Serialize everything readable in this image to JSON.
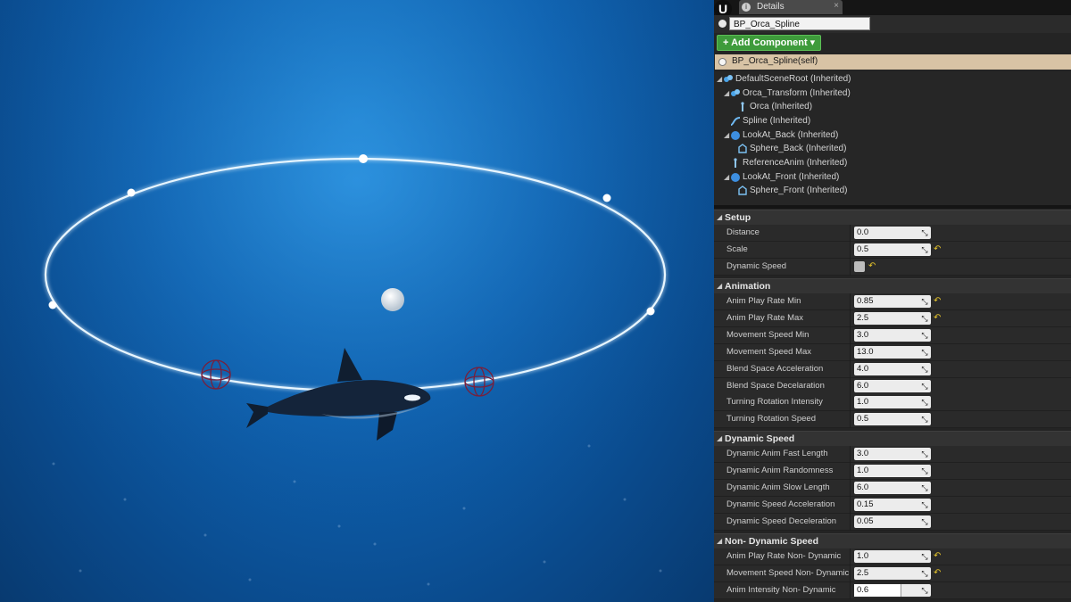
{
  "tab": {
    "label": "Details",
    "icon": "info-icon",
    "close": "×"
  },
  "engine_logo": "U",
  "actor": {
    "name_value": "BP_Orca_Spline",
    "add_component_label": "+ Add Component ▾",
    "self_label": "BP_Orca_Spline(self)"
  },
  "tree": [
    {
      "label": "DefaultSceneRoot (Inherited)",
      "icon": "scene-root-icon",
      "expander": "◢"
    },
    {
      "label": "Orca_Transform (Inherited)",
      "icon": "scene-component-icon",
      "expander": "◢"
    },
    {
      "label": "Orca (Inherited)",
      "icon": "skeletal-mesh-icon",
      "expander": ""
    },
    {
      "label": "Spline (Inherited)",
      "icon": "spline-icon",
      "expander": ""
    },
    {
      "label": "LookAt_Back (Inherited)",
      "icon": "sphere-icon",
      "expander": "◢"
    },
    {
      "label": "Sphere_Back (Inherited)",
      "icon": "static-mesh-icon",
      "expander": ""
    },
    {
      "label": "ReferenceAnim (Inherited)",
      "icon": "skeletal-mesh-icon",
      "expander": ""
    },
    {
      "label": "LookAt_Front (Inherited)",
      "icon": "sphere-icon",
      "expander": "◢"
    },
    {
      "label": "Sphere_Front (Inherited)",
      "icon": "static-mesh-icon",
      "expander": ""
    }
  ],
  "categories": [
    {
      "label": "Setup",
      "props": [
        {
          "label": "Distance",
          "value": "0.0",
          "type": "number",
          "reset": false
        },
        {
          "label": "Scale",
          "value": "0.5",
          "type": "number",
          "reset": true
        },
        {
          "label": "Dynamic Speed",
          "value": "",
          "type": "checkbox",
          "reset": true
        }
      ]
    },
    {
      "label": "Animation",
      "props": [
        {
          "label": "Anim Play Rate Min",
          "value": "0.85",
          "type": "number",
          "reset": true
        },
        {
          "label": "Anim Play Rate Max",
          "value": "2.5",
          "type": "number",
          "reset": true
        },
        {
          "label": "Movement Speed Min",
          "value": "3.0",
          "type": "number",
          "reset": false
        },
        {
          "label": "Movement Speed Max",
          "value": "13.0",
          "type": "number",
          "reset": false
        },
        {
          "label": "Blend Space Acceleration",
          "value": "4.0",
          "type": "number",
          "reset": false
        },
        {
          "label": "Blend Space Decelaration",
          "value": "6.0",
          "type": "number",
          "reset": false
        },
        {
          "label": "Turning Rotation Intensity",
          "value": "1.0",
          "type": "number",
          "reset": false
        },
        {
          "label": "Turning Rotation Speed",
          "value": "0.5",
          "type": "number",
          "reset": false
        }
      ]
    },
    {
      "label": "Dynamic Speed",
      "props": [
        {
          "label": "Dynamic Anim Fast Length",
          "value": "3.0",
          "type": "number",
          "reset": false
        },
        {
          "label": "Dynamic Anim Randomness",
          "value": "1.0",
          "type": "number",
          "reset": false
        },
        {
          "label": "Dynamic Anim Slow Length",
          "value": "6.0",
          "type": "number",
          "reset": false
        },
        {
          "label": "Dynamic Speed Acceleration",
          "value": "0.15",
          "type": "number",
          "reset": false
        },
        {
          "label": "Dynamic Speed Deceleration",
          "value": "0.05",
          "type": "number",
          "reset": false
        }
      ]
    },
    {
      "label": "Non- Dynamic Speed",
      "props": [
        {
          "label": "Anim Play Rate Non- Dynamic",
          "value": "1.0",
          "type": "number",
          "reset": true
        },
        {
          "label": "Movement Speed Non- Dynamic",
          "value": "2.5",
          "type": "number",
          "reset": true
        },
        {
          "label": "Anim Intensity Non- Dynamic",
          "value": "0.6",
          "type": "slider",
          "fill": 0.6,
          "reset": false
        }
      ]
    }
  ],
  "icons": {
    "drag": "drag-handle-icon",
    "reset": "reset-to-default-icon"
  },
  "colors": {
    "accent_green": "#3e9b3b",
    "selection": "#d8c3a5",
    "reset_yellow": "#e3c22c",
    "water": "#0f64b4",
    "spline": "#ffffff"
  }
}
